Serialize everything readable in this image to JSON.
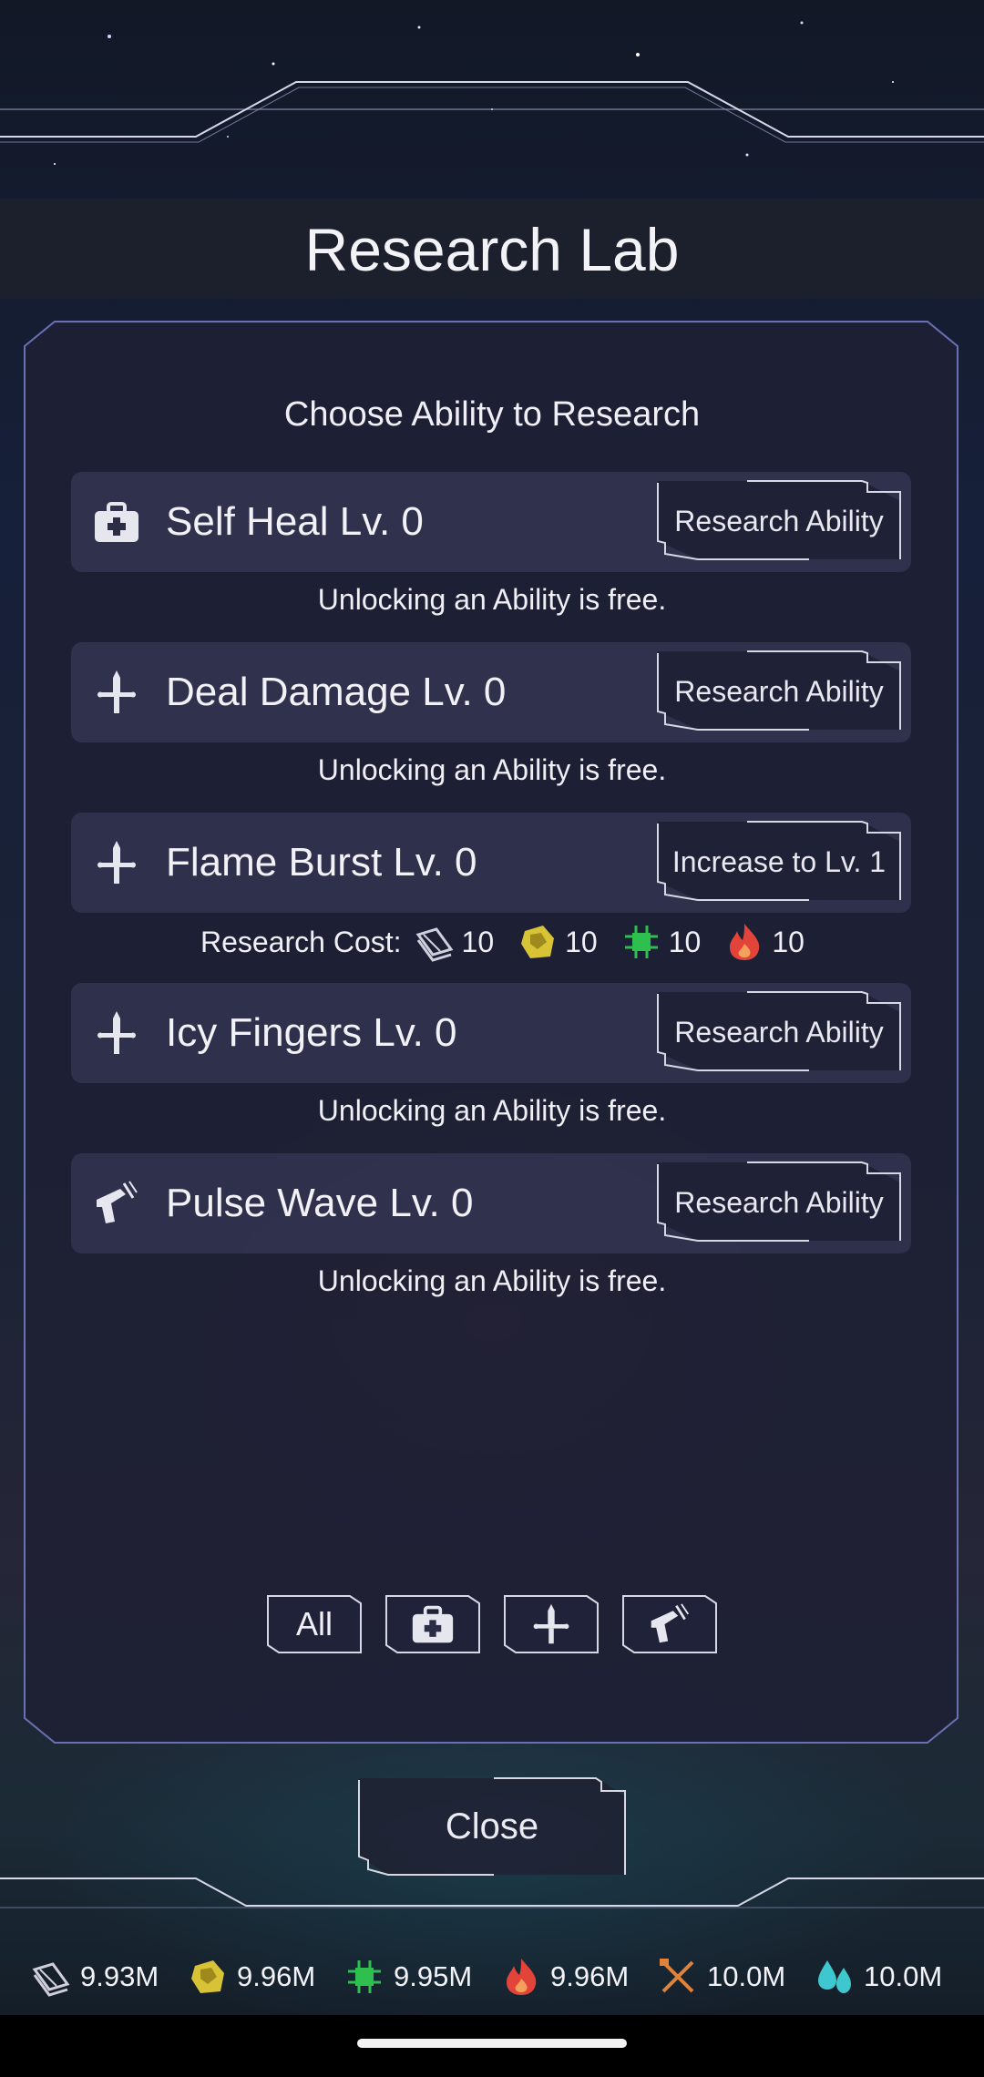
{
  "header": {
    "title": "Research Lab"
  },
  "panel": {
    "subtitle": "Choose Ability to Research",
    "abilities": [
      {
        "icon": "medkit-icon",
        "label": "Self Heal Lv. 0",
        "button": "Research Ability",
        "note": "Unlocking an Ability is free."
      },
      {
        "icon": "sword-icon",
        "label": "Deal Damage Lv. 0",
        "button": "Research Ability",
        "note": "Unlocking an Ability is free."
      },
      {
        "icon": "sword-icon",
        "label": "Flame Burst Lv. 0",
        "button": "Increase to Lv. 1",
        "note": ""
      },
      {
        "icon": "sword-icon",
        "label": "Icy Fingers Lv. 0",
        "button": "Research Ability",
        "note": "Unlocking an Ability is free."
      },
      {
        "icon": "blaster-icon",
        "label": "Pulse Wave Lv. 0",
        "button": "Research Ability",
        "note": "Unlocking an Ability is free."
      }
    ],
    "research_cost": {
      "label": "Research Cost:",
      "items": [
        {
          "icon": "metal-plates-icon",
          "value": "10"
        },
        {
          "icon": "gold-ore-icon",
          "value": "10"
        },
        {
          "icon": "circuit-chip-icon",
          "value": "10"
        },
        {
          "icon": "fire-icon",
          "value": "10"
        }
      ]
    },
    "filters": [
      {
        "label": "All",
        "icon": ""
      },
      {
        "label": "",
        "icon": "medkit-icon"
      },
      {
        "label": "",
        "icon": "sword-icon"
      },
      {
        "label": "",
        "icon": "blaster-icon"
      }
    ]
  },
  "close_label": "Close",
  "resources": [
    {
      "icon": "metal-plates-icon",
      "value": "9.93M"
    },
    {
      "icon": "gold-ore-icon",
      "value": "9.96M"
    },
    {
      "icon": "circuit-chip-icon",
      "value": "9.95M"
    },
    {
      "icon": "fire-icon",
      "value": "9.96M"
    },
    {
      "icon": "crossed-tools-icon",
      "value": "10.0M"
    },
    {
      "icon": "water-drops-icon",
      "value": "10.0M"
    }
  ],
  "colors": {
    "accent": "#5e65a8",
    "gold": "#d8c236",
    "green": "#2fbf4f",
    "fire": "#e2443a",
    "tools": "#e0823a",
    "water": "#3fc7cf"
  }
}
